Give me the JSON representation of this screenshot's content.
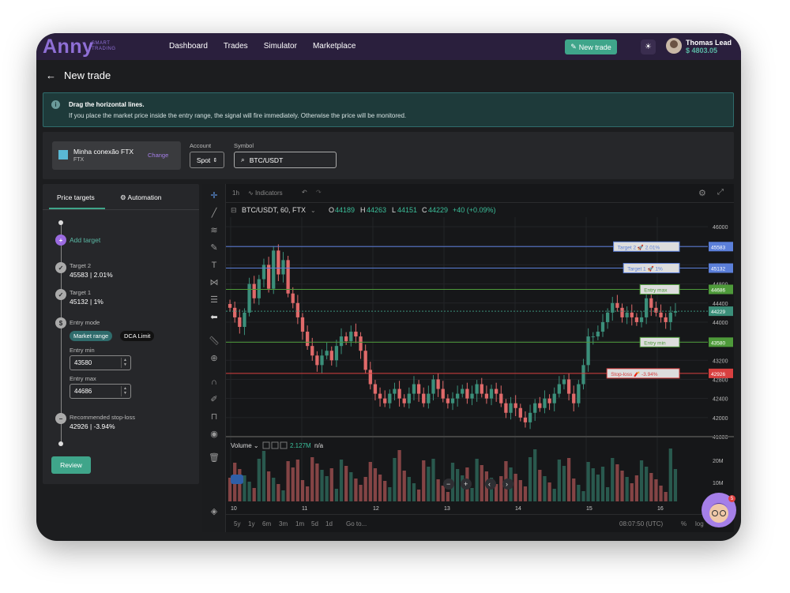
{
  "topbar": {
    "logo": "Anny",
    "logo_sub_1": "SMART",
    "logo_sub_2": "TRADING",
    "nav": [
      "Dashboard",
      "Trades",
      "Simulator",
      "Marketplace"
    ],
    "new_trade_label": "New trade",
    "user_name": "Thomas Lead",
    "user_balance": "$ 4803.05"
  },
  "page": {
    "back_icon": "arrow-left-icon",
    "title": "New trade"
  },
  "alert": {
    "title": "Drag the horizontal lines.",
    "text": "If you place the market price inside the entry range, the signal will fire immediately. Otherwise the price will be monitored."
  },
  "connection": {
    "name": "Minha conexão FTX",
    "exchange": "FTX",
    "change_label": "Change",
    "account_label": "Account",
    "account_value": "Spot",
    "symbol_label": "Symbol",
    "symbol_value": "BTC/USDT"
  },
  "left_panel": {
    "tabs": [
      "Price targets",
      "Automation"
    ],
    "add_target": "Add target",
    "target2_label": "Target 2",
    "target2_value": "45583 | 2.01%",
    "target1_label": "Target 1",
    "target1_value": "45132 | 1%",
    "entry_mode_label": "Entry mode",
    "entry_mode_options": [
      "Market range",
      "DCA Limit"
    ],
    "entry_min_label": "Entry min",
    "entry_min_value": "43580",
    "entry_max_label": "Entry max",
    "entry_max_value": "44686",
    "stoploss_label": "Recommended stop-loss",
    "stoploss_value": "42926 | -3.94%",
    "review_label": "Review"
  },
  "chart_toolbar": {
    "interval": "1h",
    "indicators": "Indicators"
  },
  "chart_data": {
    "type": "candlestick",
    "title": "BTC/USDT, 60, FTX",
    "ohlc_line": {
      "O": "44189",
      "H": "44263",
      "L": "44151",
      "C": "44229",
      "change": "+40 (+0.09%)"
    },
    "y_ticks": [
      46000,
      45600,
      45200,
      44800,
      44400,
      44000,
      43600,
      43200,
      42800,
      42400,
      42000,
      41600
    ],
    "ylim": [
      41600,
      46200
    ],
    "x_ticks": [
      "10",
      "11",
      "12",
      "13",
      "14",
      "15",
      "16"
    ],
    "current_price": 44229,
    "levels": [
      {
        "label": "Target 2 🚀 2.01%",
        "price": 45583,
        "color": "#5b7fd9"
      },
      {
        "label": "Target 1 🚀 1%",
        "price": 45132,
        "color": "#5b7fd9"
      },
      {
        "label": "Entry max",
        "price": 44686,
        "color": "#4e9a3a"
      },
      {
        "label": "Entry min",
        "price": 43580,
        "color": "#4e9a3a"
      },
      {
        "label": "Stop-loss 🧨 -3.94%",
        "price": 42926,
        "color": "#d94040"
      }
    ],
    "closes": [
      44300,
      44100,
      43900,
      44200,
      44800,
      44500,
      44900,
      45200,
      44700,
      45500,
      45000,
      45300,
      44600,
      44400,
      44100,
      43800,
      43500,
      43300,
      43100,
      43300,
      43400,
      43200,
      43500,
      43700,
      43600,
      43800,
      43700,
      43400,
      43000,
      42700,
      42500,
      42400,
      42300,
      42500,
      42600,
      42400,
      42300,
      42500,
      42700,
      42500,
      42300,
      42500,
      42800,
      42600,
      42400,
      42300,
      42400,
      42500,
      42600,
      42400,
      42500,
      42700,
      42500,
      42400,
      42600,
      42500,
      42300,
      42100,
      42300,
      42200,
      42000,
      41900,
      42100,
      42300,
      42200,
      42400,
      42300,
      42500,
      42700,
      42800,
      42500,
      42300,
      42700,
      43100,
      43700,
      43700,
      43800,
      44000,
      44200,
      44400,
      44300,
      44100,
      44200,
      44100,
      44000,
      44100,
      44500,
      44300,
      44200,
      44100,
      44000,
      44200,
      44229
    ],
    "volume_label": "Volume",
    "volume_value": "2.127M",
    "volume_na": "n/a",
    "volume_ticks": [
      "20M",
      "10M"
    ]
  },
  "bottom_bar": {
    "ranges": [
      "5y",
      "1y",
      "6m",
      "3m",
      "1m",
      "5d",
      "1d"
    ],
    "goto": "Go to...",
    "time": "08:07:50 (UTC)",
    "percent": "%",
    "log": "log"
  },
  "chat": {
    "badge": "5"
  },
  "colors": {
    "accent": "#3fa58a",
    "brand": "#8f6fd6",
    "up": "#3b8f7a",
    "down": "#e06a6a"
  }
}
